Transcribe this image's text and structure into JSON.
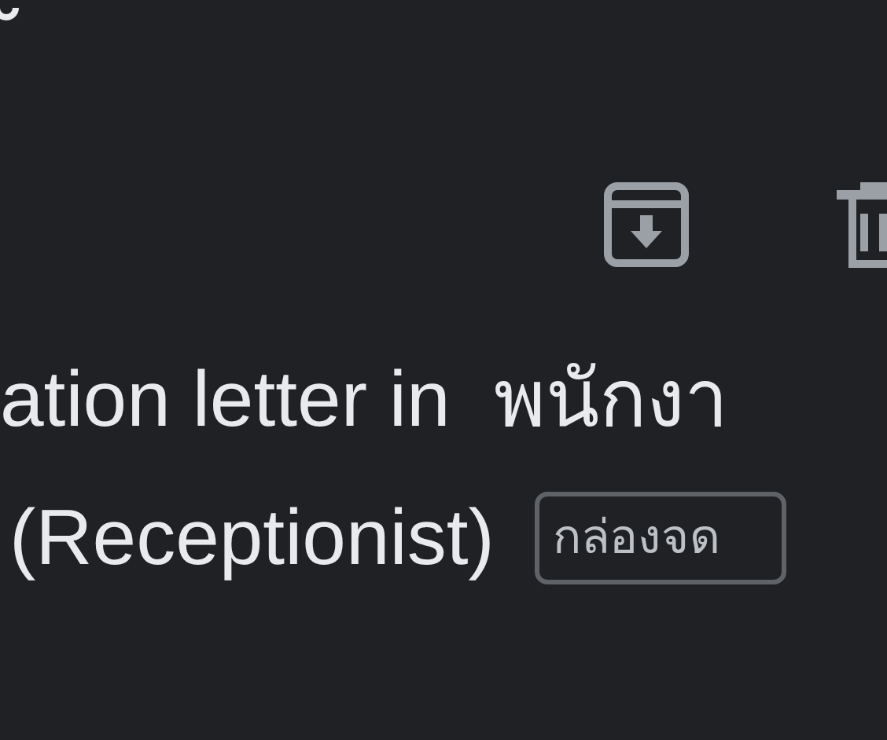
{
  "toolbar": {
    "actions": [
      {
        "kind": "archive"
      },
      {
        "kind": "delete"
      }
    ]
  },
  "subject": {
    "lines": [
      "ation letter in  พนักงา",
      "(Receptionist)"
    ],
    "label": "กล่องจด"
  }
}
